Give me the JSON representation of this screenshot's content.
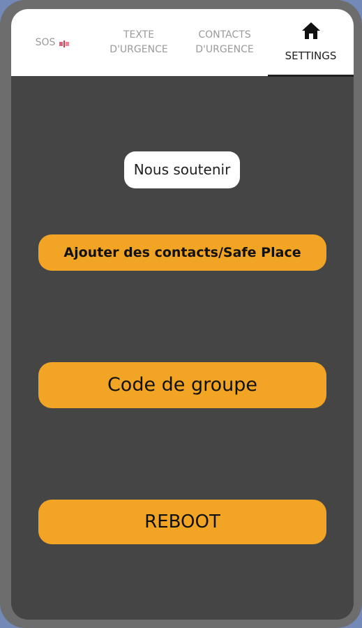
{
  "tabs": {
    "sos": {
      "label": "SOS",
      "icon": "flag-icon"
    },
    "texte": {
      "line1": "TEXTE",
      "line2": "D'URGENCE"
    },
    "contacts": {
      "line1": "CONTACTS",
      "line2": "D'URGENCE"
    },
    "settings": {
      "label": "SETTINGS",
      "icon": "home-icon",
      "active": true
    }
  },
  "main": {
    "nous_soutenir_label": "Nous soutenir",
    "add_contacts_label": "Ajouter des contacts/Safe Place",
    "group_code_label": "Code de groupe",
    "reboot_label": "REBOOT"
  },
  "colors": {
    "background": "#454545",
    "tabbar": "#ffffff",
    "accent": "#f2a424",
    "frame": "#6d6d6d",
    "outer": "#7389b8"
  }
}
